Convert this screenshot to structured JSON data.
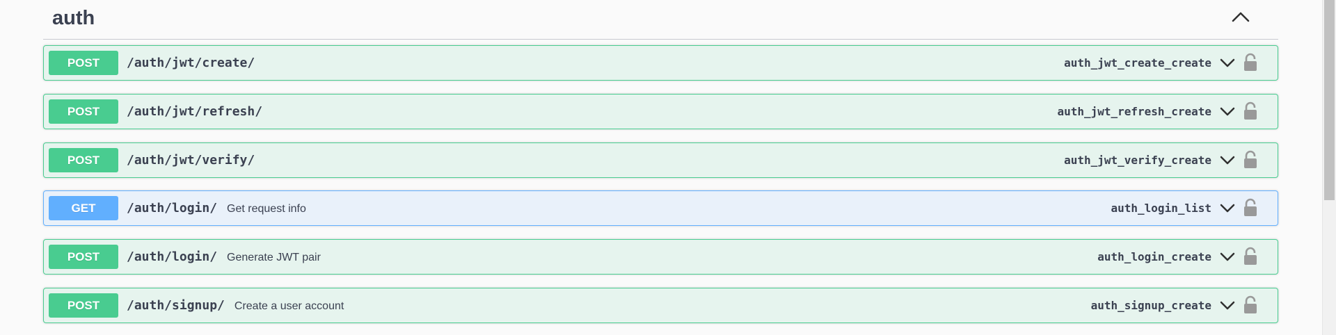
{
  "section": {
    "title": "auth",
    "toggle_icon": "chevron-up-icon"
  },
  "operations": [
    {
      "method": "POST",
      "path": "/auth/jwt/create/",
      "summary": "",
      "operation_id": "auth_jwt_create_create",
      "lock_icon": "lock-open-icon",
      "expand_icon": "chevron-down-icon"
    },
    {
      "method": "POST",
      "path": "/auth/jwt/refresh/",
      "summary": "",
      "operation_id": "auth_jwt_refresh_create",
      "lock_icon": "lock-open-icon",
      "expand_icon": "chevron-down-icon"
    },
    {
      "method": "POST",
      "path": "/auth/jwt/verify/",
      "summary": "",
      "operation_id": "auth_jwt_verify_create",
      "lock_icon": "lock-open-icon",
      "expand_icon": "chevron-down-icon"
    },
    {
      "method": "GET",
      "path": "/auth/login/",
      "summary": "Get request info",
      "operation_id": "auth_login_list",
      "lock_icon": "lock-open-icon",
      "expand_icon": "chevron-down-icon"
    },
    {
      "method": "POST",
      "path": "/auth/login/",
      "summary": "Generate JWT pair",
      "operation_id": "auth_login_create",
      "lock_icon": "lock-open-icon",
      "expand_icon": "chevron-down-icon"
    },
    {
      "method": "POST",
      "path": "/auth/signup/",
      "summary": "Create a user account",
      "operation_id": "auth_signup_create",
      "lock_icon": "lock-open-icon",
      "expand_icon": "chevron-down-icon"
    }
  ],
  "colors": {
    "post": "#49cc90",
    "get": "#61affe",
    "text": "#3b4151"
  }
}
